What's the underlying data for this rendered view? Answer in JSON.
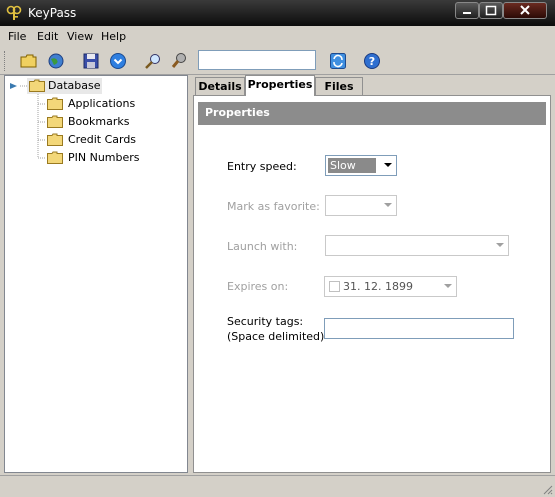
{
  "window": {
    "title": "KeyPass"
  },
  "menu": [
    "File",
    "Edit",
    "View",
    "Help"
  ],
  "toolbar": {
    "buttons": [
      "open-folder-icon",
      "globe-icon",
      "save-icon",
      "download-icon",
      "search-icon",
      "tools-icon",
      "sync-icon",
      "help-icon"
    ],
    "search_value": ""
  },
  "tree": {
    "root": "Database",
    "children": [
      "Applications",
      "Bookmarks",
      "Credit Cards",
      "PIN Numbers"
    ]
  },
  "tabs": [
    {
      "label": "Details"
    },
    {
      "label": "Properties"
    },
    {
      "label": "Files"
    }
  ],
  "active_tab": "Properties",
  "properties": {
    "header": "Properties",
    "entry_speed": {
      "label": "Entry speed:",
      "value": "Slow"
    },
    "mark_favorite": {
      "label": "Mark as favorite:",
      "value": ""
    },
    "launch_with": {
      "label": "Launch with:",
      "value": ""
    },
    "expires_on": {
      "label": "Expires on:",
      "value": "31. 12. 1899"
    },
    "security_tags": {
      "label_line1": "Security tags:",
      "label_line2": "(Space delimited)",
      "value": ""
    }
  },
  "colors": {
    "titlebar": "#0c0c0c",
    "window_face": "#d4d0c8",
    "panel_header": "#8c8c8c",
    "selected_tree_item": "#e8e8e8"
  }
}
